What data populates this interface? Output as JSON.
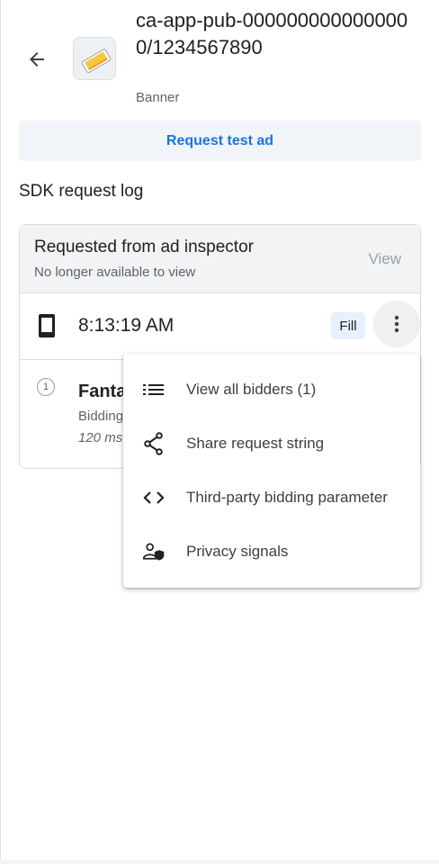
{
  "header": {
    "ad_unit_id": "ca-app-pub-0000000000000000/1234567890",
    "ad_format": "Banner",
    "back_icon": "arrow-back-icon",
    "app_icon": "app-icon"
  },
  "request_button": {
    "label": "Request test ad",
    "color": "#1a73e8"
  },
  "section": {
    "title": "SDK request log"
  },
  "log_card": {
    "title": "Requested from ad inspector",
    "subtitle": "No longer available to view",
    "view_label": "View"
  },
  "request": {
    "time": "8:13:19 AM",
    "status": "Fill",
    "device_icon": "phone-icon",
    "more_icon": "more-vert-icon"
  },
  "bidder": {
    "rank": "1",
    "name": "Fanta",
    "type": "Bidding",
    "latency": "120 ms"
  },
  "menu": {
    "items": [
      {
        "label": "View all bidders (1)",
        "icon": "list-icon"
      },
      {
        "label": "Share request string",
        "icon": "share-icon"
      },
      {
        "label": "Third-party bidding parameter",
        "icon": "code-icon"
      },
      {
        "label": "Privacy signals",
        "icon": "privacy-icon"
      }
    ]
  }
}
